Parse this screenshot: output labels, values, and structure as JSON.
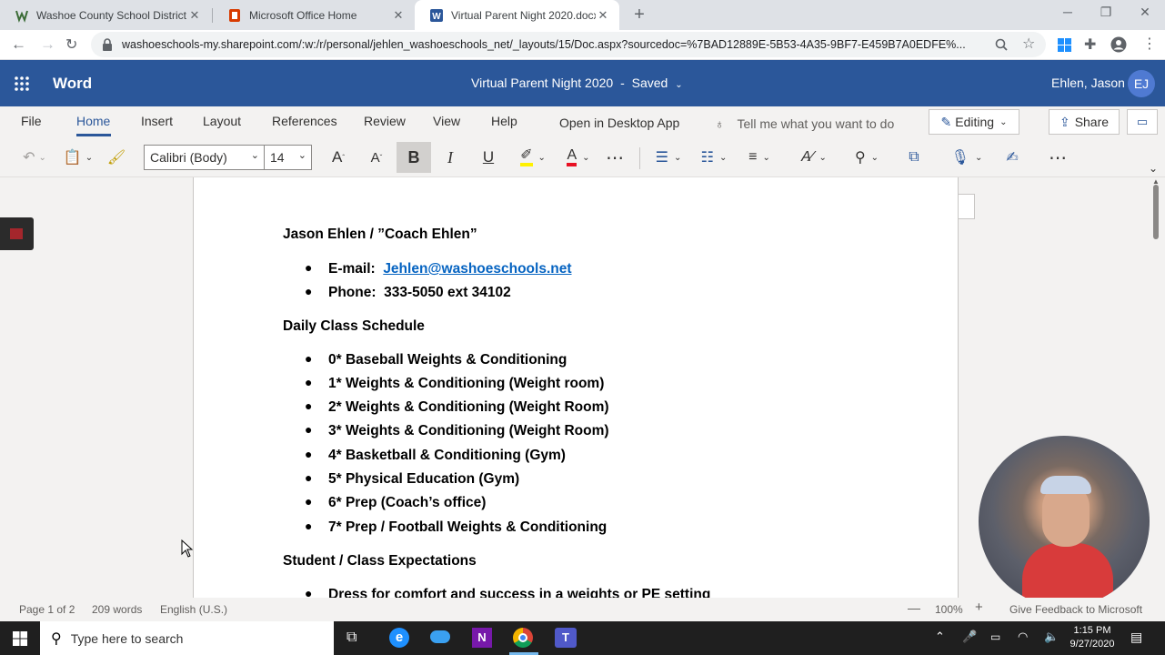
{
  "browser": {
    "tabs": [
      {
        "title": "Washoe County School District /",
        "active": false
      },
      {
        "title": "Microsoft Office Home",
        "active": false
      },
      {
        "title": "Virtual Parent Night 2020.docx",
        "active": true
      }
    ],
    "url": "washoeschools-my.sharepoint.com/:w:/r/personal/jehlen_washoeschools_net/_layouts/15/Doc.aspx?sourcedoc=%7BAD12889E-5B53-4A35-9BF7-E459B7A0EDFE%..."
  },
  "app": {
    "name": "Word",
    "doc_title": "Virtual Parent Night 2020",
    "doc_sep": "-",
    "save_state": "Saved",
    "user_name": "Ehlen, Jason",
    "user_initials": "EJ",
    "brand_color": "#2b579a"
  },
  "ribbon": {
    "tabs": [
      "File",
      "Home",
      "Insert",
      "Layout",
      "References",
      "Review",
      "View",
      "Help"
    ],
    "open_desktop": "Open in Desktop App",
    "tell_me": "Tell me what you want to do",
    "editing": "Editing",
    "share": "Share",
    "font_name": "Calibri (Body)",
    "font_size": "14"
  },
  "document": {
    "name_line": "Jason Ehlen / ”Coach Ehlen”",
    "contact": [
      {
        "label": "E-mail:",
        "value": "Jehlen@washoeschools.net"
      },
      {
        "label": "Phone:",
        "value": "333-5050 ext 34102"
      }
    ],
    "schedule_heading": "Daily Class Schedule",
    "schedule": [
      "0* Baseball Weights & Conditioning",
      "1* Weights & Conditioning (Weight room)",
      "2* Weights & Conditioning (Weight Room)",
      "3* Weights & Conditioning (Weight Room)",
      "4* Basketball & Conditioning  (Gym)",
      "5* Physical Education  (Gym)",
      "6* Prep (Coach’s office)",
      "7* Prep / Football Weights & Conditioning"
    ],
    "expectations_heading": "Student / Class Expectations",
    "expectations": [
      "Dress for comfort and success in a weights or PE setting"
    ]
  },
  "status": {
    "page": "Page 1 of 2",
    "words": "209 words",
    "language": "English (U.S.)",
    "zoom": "100%",
    "feedback": "Give Feedback to Microsoft"
  },
  "taskbar": {
    "search_placeholder": "Type here to search",
    "time": "1:15 PM",
    "date": "9/27/2020"
  }
}
